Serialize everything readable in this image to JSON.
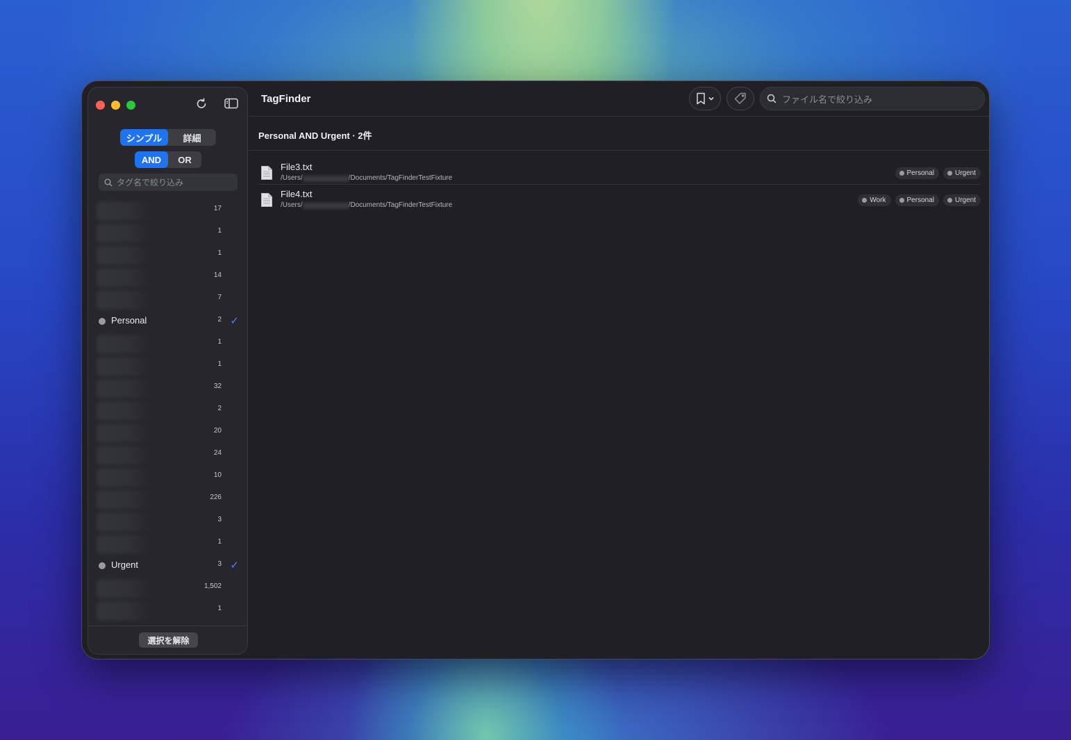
{
  "app": {
    "title": "TagFinder"
  },
  "sidebar": {
    "mode_segment": {
      "simple": "シンプル",
      "detail": "詳細",
      "selected": "simple"
    },
    "logic_segment": {
      "and": "AND",
      "or": "OR",
      "selected": "and"
    },
    "tag_search_placeholder": "タグ名で絞り込み",
    "tags": [
      {
        "name": "",
        "count": "17",
        "selected": false
      },
      {
        "name": "",
        "count": "1",
        "selected": false
      },
      {
        "name": "",
        "count": "1",
        "selected": false
      },
      {
        "name": "",
        "count": "14",
        "selected": false
      },
      {
        "name": "",
        "count": "7",
        "selected": false
      },
      {
        "name": "Personal",
        "count": "2",
        "selected": true
      },
      {
        "name": "",
        "count": "1",
        "selected": false
      },
      {
        "name": "",
        "count": "1",
        "selected": false
      },
      {
        "name": "",
        "count": "32",
        "selected": false
      },
      {
        "name": "",
        "count": "2",
        "selected": false
      },
      {
        "name": "",
        "count": "20",
        "selected": false
      },
      {
        "name": "",
        "count": "24",
        "selected": false
      },
      {
        "name": "",
        "count": "10",
        "selected": false
      },
      {
        "name": "",
        "count": "226",
        "selected": false
      },
      {
        "name": "",
        "count": "3",
        "selected": false
      },
      {
        "name": "",
        "count": "1",
        "selected": false
      },
      {
        "name": "Urgent",
        "count": "3",
        "selected": true
      },
      {
        "name": "",
        "count": "1,502",
        "selected": false
      },
      {
        "name": "",
        "count": "1",
        "selected": false
      }
    ],
    "clear_button": "選択を解除"
  },
  "toolbar": {
    "file_search_placeholder": "ファイル名で絞り込み"
  },
  "results": {
    "header": "Personal AND Urgent · 2件",
    "files": [
      {
        "name": "File3.txt",
        "path_prefix": "/Users/",
        "path_suffix": "/Documents/TagFinderTestFixture",
        "tags": [
          "Personal",
          "Urgent"
        ]
      },
      {
        "name": "File4.txt",
        "path_prefix": "/Users/",
        "path_suffix": "/Documents/TagFinderTestFixture",
        "tags": [
          "Work",
          "Personal",
          "Urgent"
        ]
      }
    ]
  },
  "colors": {
    "accent": "#1f73f0",
    "check": "#3d8bff",
    "window_bg": "#1f1f25",
    "sidebar_bg": "#26262c"
  }
}
